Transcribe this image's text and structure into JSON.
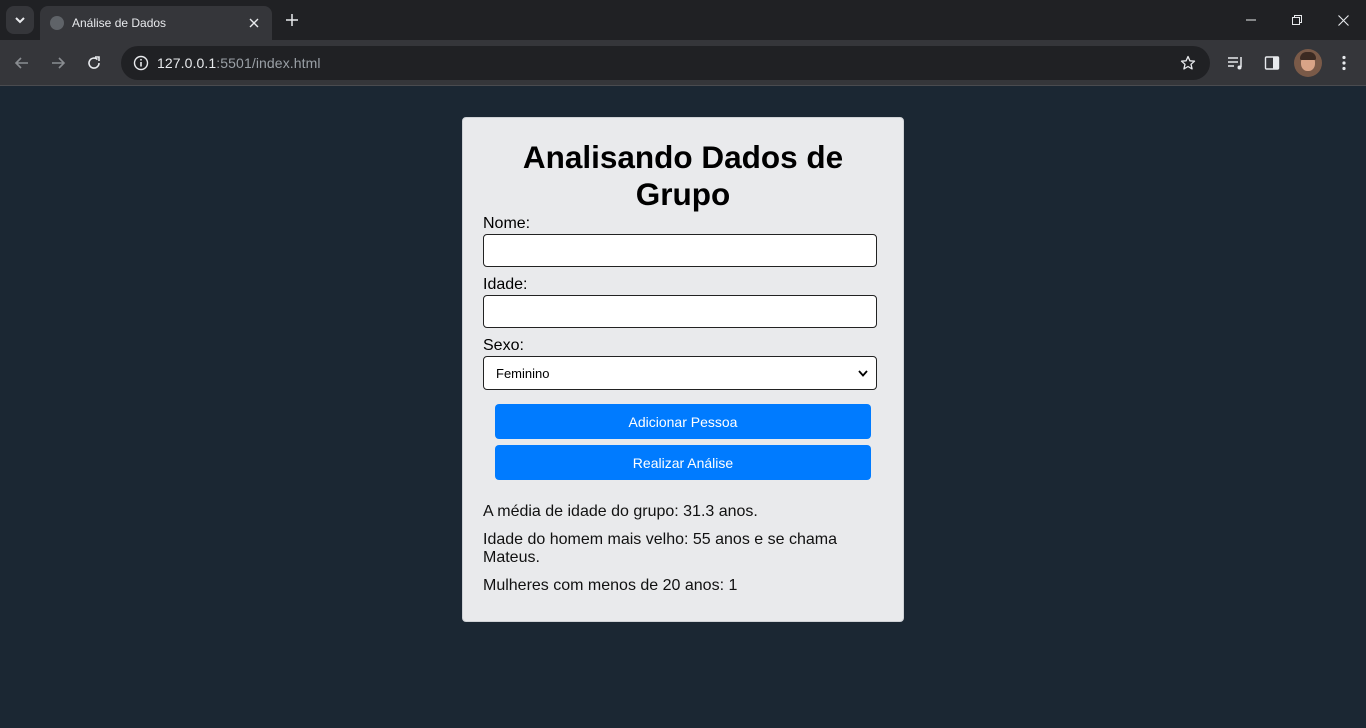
{
  "browser": {
    "tab_title": "Análise de Dados",
    "url_host": "127.0.0.1",
    "url_rest": ":5501/index.html"
  },
  "page": {
    "title": "Analisando Dados de Grupo",
    "form": {
      "name_label": "Nome:",
      "name_value": "",
      "age_label": "Idade:",
      "age_value": "",
      "sex_label": "Sexo:",
      "sex_selected": "Feminino"
    },
    "buttons": {
      "add": "Adicionar Pessoa",
      "analyze": "Realizar Análise"
    },
    "results": {
      "average_age": "A média de idade do grupo: 31.3 anos.",
      "oldest_man": "Idade do homem mais velho: 55 anos e se chama Mateus.",
      "women_under_20": "Mulheres com menos de 20 anos: 1"
    }
  },
  "colors": {
    "page_background": "#1b2733",
    "card_background": "#e9eaec",
    "button_primary": "#007bff"
  }
}
